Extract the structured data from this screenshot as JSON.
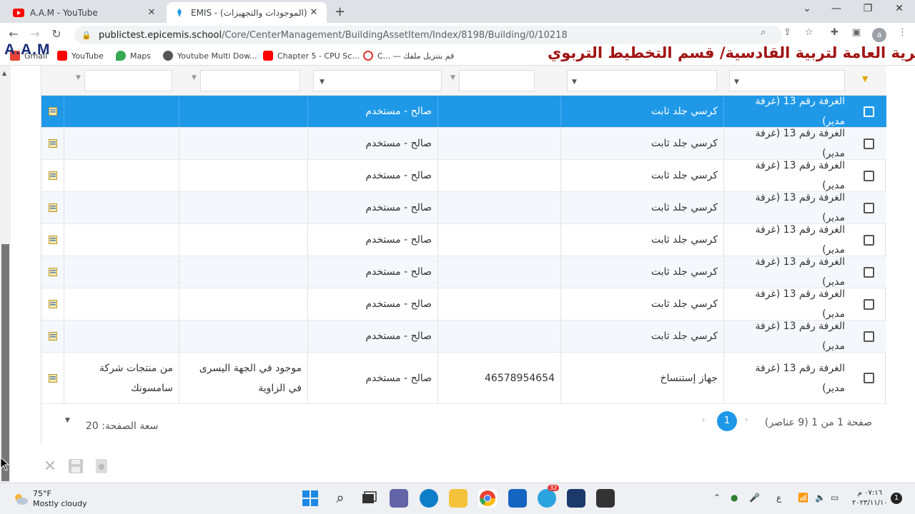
{
  "browser": {
    "tabs": [
      {
        "title": "A.A.M - YouTube",
        "icon": "youtube-icon"
      },
      {
        "title": "EMIS - (الموجودات والتجهيزات) ول...",
        "icon": "emis-icon"
      }
    ],
    "url_host": "publictest.epicemis.school",
    "url_path": "/Core/CenterManagement/BuildingAssetItem/Index/8198/Building/0/10218",
    "profile_letter": "a",
    "bookmarks": [
      "Gmail",
      "YouTube",
      "Maps",
      "Youtube Multi Dow...",
      "Chapter 5 - CPU Sc...",
      "C... — قم بتنزيل ملفك"
    ]
  },
  "overlay": {
    "logo": "A.A.M",
    "title": "المديرية العامة لتربية القادسية/ قسم التخطيط التربوي"
  },
  "grid": {
    "rows": [
      {
        "location": "الغرفة رقم 13 (غرفة مدير)",
        "item": "كرسي جلد ثابت",
        "serial": "",
        "status": "صالح - مستخدم",
        "notes": "",
        "extra": "",
        "selected": true
      },
      {
        "location": "الغرفة رقم 13 (غرفة مدير)",
        "item": "كرسي جلد ثابت",
        "serial": "",
        "status": "صالح - مستخدم",
        "notes": "",
        "extra": "",
        "selected": false
      },
      {
        "location": "الغرفة رقم 13 (غرفة مدير)",
        "item": "كرسي جلد ثابت",
        "serial": "",
        "status": "صالح - مستخدم",
        "notes": "",
        "extra": "",
        "selected": false
      },
      {
        "location": "الغرفة رقم 13 (غرفة مدير)",
        "item": "كرسي جلد ثابت",
        "serial": "",
        "status": "صالح - مستخدم",
        "notes": "",
        "extra": "",
        "selected": false
      },
      {
        "location": "الغرفة رقم 13 (غرفة مدير)",
        "item": "كرسي جلد ثابت",
        "serial": "",
        "status": "صالح - مستخدم",
        "notes": "",
        "extra": "",
        "selected": false
      },
      {
        "location": "الغرفة رقم 13 (غرفة مدير)",
        "item": "كرسي جلد ثابت",
        "serial": "",
        "status": "صالح - مستخدم",
        "notes": "",
        "extra": "",
        "selected": false
      },
      {
        "location": "الغرفة رقم 13 (غرفة مدير)",
        "item": "كرسي جلد ثابت",
        "serial": "",
        "status": "صالح - مستخدم",
        "notes": "",
        "extra": "",
        "selected": false
      },
      {
        "location": "الغرفة رقم 13 (غرفة مدير)",
        "item": "كرسي جلد ثابت",
        "serial": "",
        "status": "صالح - مستخدم",
        "notes": "",
        "extra": "",
        "selected": false
      },
      {
        "location": "الغرفة رقم 13 (غرفة مدير)",
        "item": "جهاز إستنساخ",
        "serial": "46578954654",
        "status": "صالح - مستخدم",
        "notes": "موجود في الجهة اليسرى في الزاوية",
        "extra": "من منتجات شركة سامسونك",
        "selected": false
      }
    ],
    "pager": {
      "info": "صفحة 1 من 1 (9 عناصر)",
      "current_page": "1",
      "page_size_label": "سعة الصفحة:",
      "page_size": "20"
    }
  },
  "taskbar": {
    "temperature": "75°F",
    "weather": "Mostly cloudy",
    "time": "٠٧:١٦ م",
    "date": "٢٠٢٣/١١/١٠",
    "language": "ع",
    "telegram_badge": "32",
    "notifications": "1"
  },
  "colors": {
    "accent": "#1f98e8",
    "overlay_title": "#a11414",
    "logo": "#1a2f7a"
  }
}
